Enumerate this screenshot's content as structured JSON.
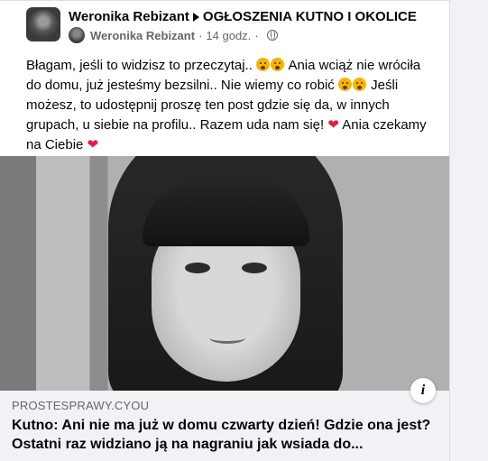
{
  "post": {
    "author": "Weronika Rebizant",
    "group": "OGŁOSZENIA KUTNO I OKOLICE",
    "sub_author": "Weronika Rebizant",
    "time": "14 godz.",
    "text_parts": {
      "p1": "Błagam, jeśli to widzisz to przeczytaj..",
      "p2": " Ania wciąż nie wróciła do domu, już jesteśmy bezsilni.. Nie wiemy co robić",
      "p3": " Jeśli możesz, to udostępnij proszę ten post gdzie się da, w innych grupach, u siebie na profilu.. Razem uda nam się!",
      "p4": " Ania czekamy na Ciebie"
    },
    "heart": "❤"
  },
  "link": {
    "domain": "PROSTESPRAWY.CYOU",
    "title": "Kutno: Ani nie ma już w domu czwarty dzień! Gdzie ona jest? Ostatni raz widziano ją na nagraniu jak wsiada do..."
  },
  "icons": {
    "info": "i",
    "separator": "·"
  }
}
